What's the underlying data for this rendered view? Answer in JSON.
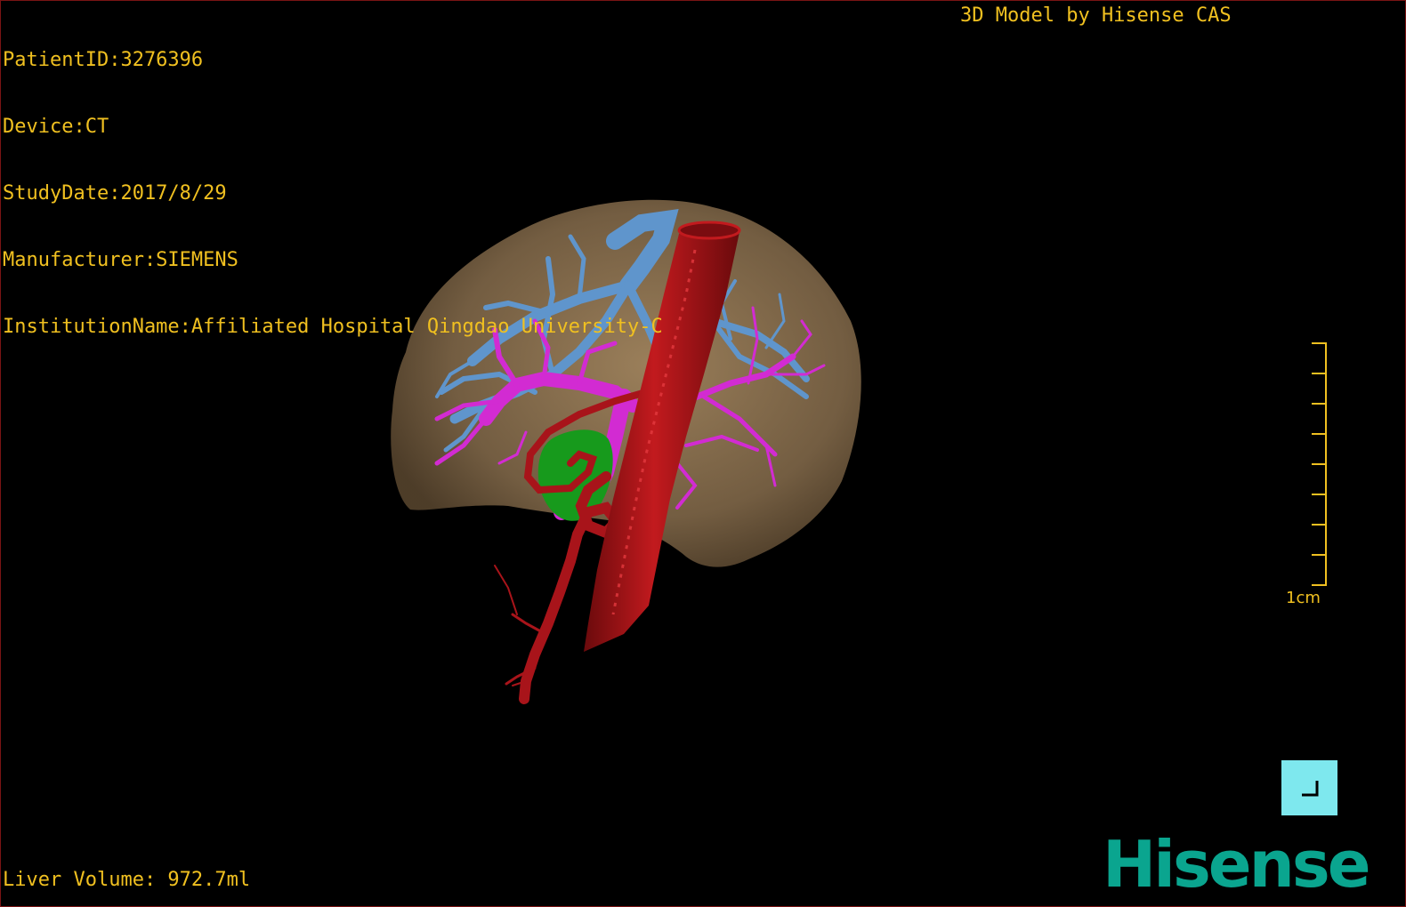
{
  "patient_info": {
    "patient_id": "PatientID:3276396",
    "device": "Device:CT",
    "study_date": "StudyDate:2017/8/29",
    "manufacturer": "Manufacturer:SIEMENS",
    "institution": "InstitutionName:Affiliated Hospital Qingdao University-C"
  },
  "model_credit": "3D Model by Hisense CAS",
  "liver_volume": "Liver Volume: 972.7ml",
  "scale_bar": {
    "label": "1cm",
    "ticks": 8
  },
  "logo_text": "Hisense",
  "view_button": {
    "icon": "corner-axes-icon"
  },
  "colors": {
    "overlay_text": "#f0c020",
    "liver": "#8b7250",
    "hepatic_vein": "#5f95cc",
    "portal_vein": "#d22bd2",
    "artery": "#b01519",
    "gallbladder": "#179a1c",
    "logo": "#0aa58f",
    "view_button": "#7ee8ee"
  },
  "structures": [
    "liver",
    "hepatic-vein",
    "portal-vein",
    "artery",
    "gallbladder"
  ]
}
